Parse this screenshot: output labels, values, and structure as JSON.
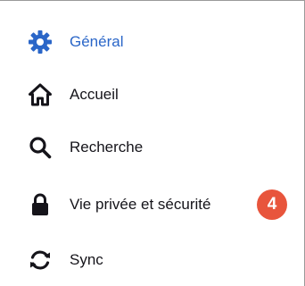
{
  "colors": {
    "selected": "#2a66c8",
    "text": "#15141a",
    "badge": "#e8553c"
  },
  "sidebar": {
    "items": [
      {
        "label": "Général",
        "icon": "gear-icon",
        "selected": true
      },
      {
        "label": "Accueil",
        "icon": "home-icon",
        "selected": false
      },
      {
        "label": "Recherche",
        "icon": "search-icon",
        "selected": false
      },
      {
        "label": "Vie privée et sécurité",
        "icon": "lock-icon",
        "selected": false,
        "badge": "4"
      },
      {
        "label": "Sync",
        "icon": "sync-icon",
        "selected": false
      }
    ]
  }
}
